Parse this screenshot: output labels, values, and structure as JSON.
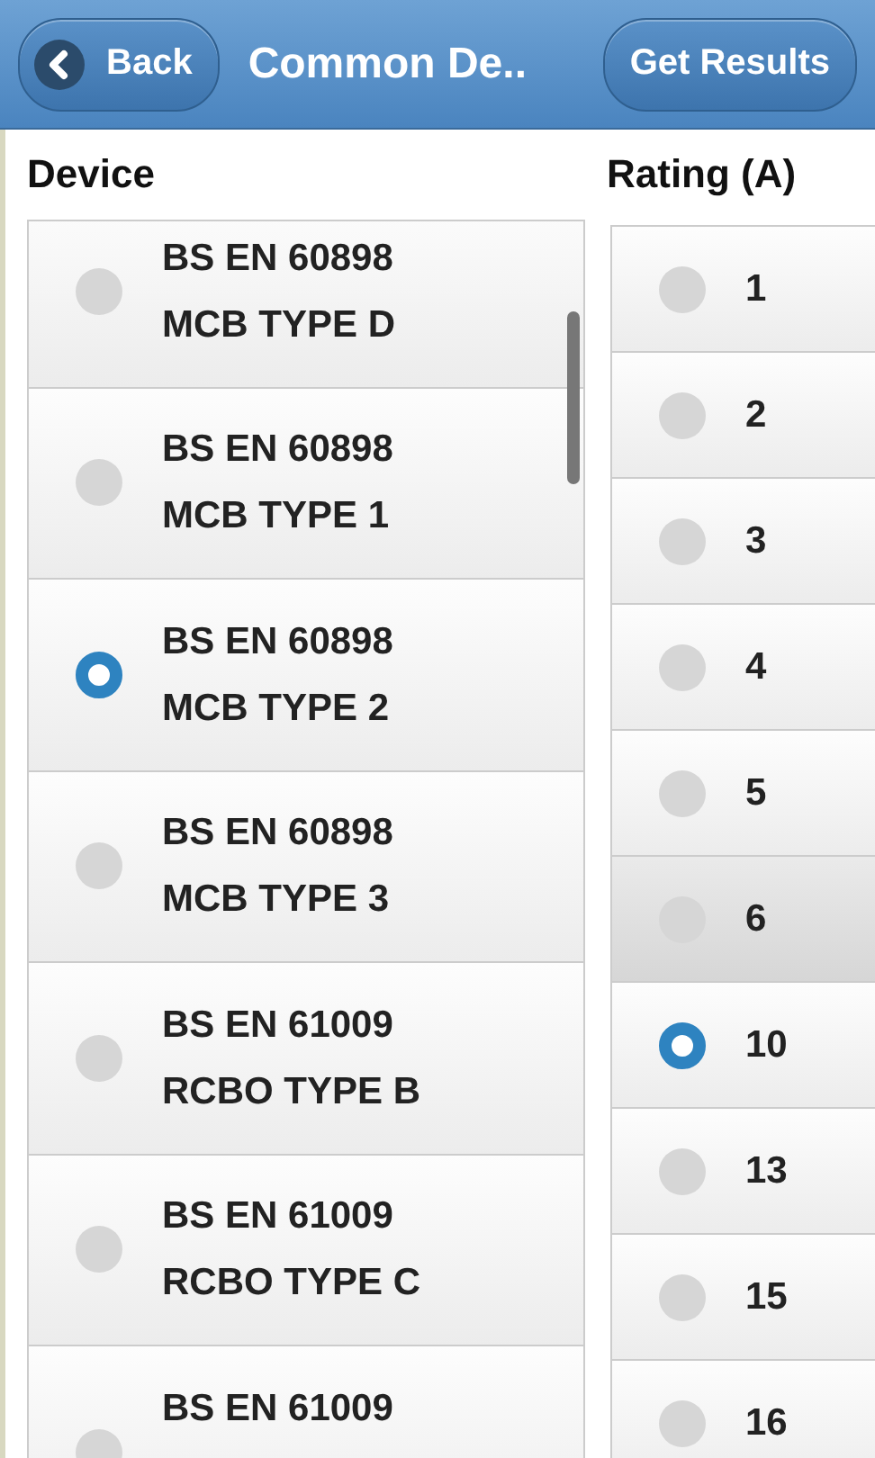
{
  "header": {
    "back_button": "Back",
    "title": "Common De..",
    "action_button": "Get Results"
  },
  "device_column": {
    "heading": "Device",
    "items": [
      {
        "line_1": "BS EN 60898",
        "line_2": "MCB TYPE D",
        "selected": false
      },
      {
        "line_1": "BS EN 60898",
        "line_2": "MCB TYPE 1",
        "selected": false
      },
      {
        "line_1": "BS EN 60898",
        "line_2": "MCB TYPE 2",
        "selected": true
      },
      {
        "line_1": "BS EN 60898",
        "line_2": "MCB TYPE 3",
        "selected": false
      },
      {
        "line_1": "BS EN 61009",
        "line_2": "RCBO TYPE B",
        "selected": false
      },
      {
        "line_1": "BS EN 61009",
        "line_2": "RCBO TYPE C",
        "selected": false
      },
      {
        "line_1": "BS EN 61009",
        "selected": false
      }
    ]
  },
  "rating_column": {
    "heading": "Rating (A)",
    "items": [
      {
        "label": "1",
        "selected": false,
        "highlighted": false
      },
      {
        "label": "2",
        "selected": false,
        "highlighted": false
      },
      {
        "label": "3",
        "selected": false,
        "highlighted": false
      },
      {
        "label": "4",
        "selected": false,
        "highlighted": false
      },
      {
        "label": "5",
        "selected": false,
        "highlighted": false
      },
      {
        "label": "6",
        "selected": false,
        "highlighted": true
      },
      {
        "label": "10",
        "selected": true,
        "highlighted": false
      },
      {
        "label": "13",
        "selected": false,
        "highlighted": false
      },
      {
        "label": "15",
        "selected": false,
        "highlighted": false
      },
      {
        "label": "16",
        "selected": false,
        "highlighted": false
      }
    ]
  }
}
